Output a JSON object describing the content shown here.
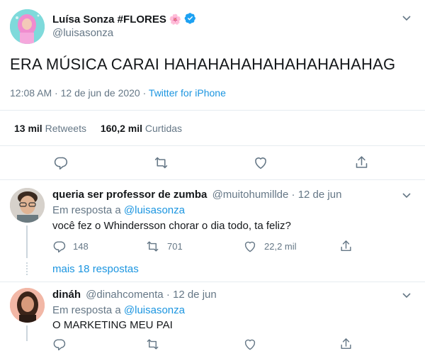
{
  "tweet": {
    "author_name": "Luísa Sonza #FLORES",
    "author_emoji": "🌸",
    "author_handle": "@luisasonza",
    "text": "ERA MÚSICA CARAI HAHAHAHAHAHAHAHAHAHAG",
    "time": "12:08 AM",
    "date_sep": " · ",
    "date": "12 de jun de 2020",
    "source_sep": " · ",
    "source": "Twitter for iPhone",
    "retweets_count": "13 mil",
    "retweets_label": "Retweets",
    "likes_count": "160,2 mil",
    "likes_label": "Curtidas"
  },
  "replies": [
    {
      "name": "queria ser professor de zumba",
      "handle": "@muitohumillde",
      "date": "12 de jun",
      "reply_prefix": "Em resposta a",
      "reply_to": "@luisasonza",
      "text": "você fez o Whindersson chorar o dia todo, ta feliz?",
      "reply_count": "148",
      "retweet_count": "701",
      "like_count": "22,2 mil",
      "more_replies": "mais 18 respostas"
    },
    {
      "name": "dináh",
      "handle": "@dinahcomenta",
      "date": "12 de jun",
      "reply_prefix": "Em resposta a",
      "reply_to": "@luisasonza",
      "text": "O MARKETING MEU PAI"
    }
  ],
  "colors": {
    "link": "#1b95e0",
    "verified": "#1da1f2",
    "muted": "#657786",
    "divider": "#e6ecf0"
  },
  "icons": [
    "chevron-down-icon",
    "verified-icon",
    "reply-icon",
    "retweet-icon",
    "like-icon",
    "share-icon"
  ]
}
